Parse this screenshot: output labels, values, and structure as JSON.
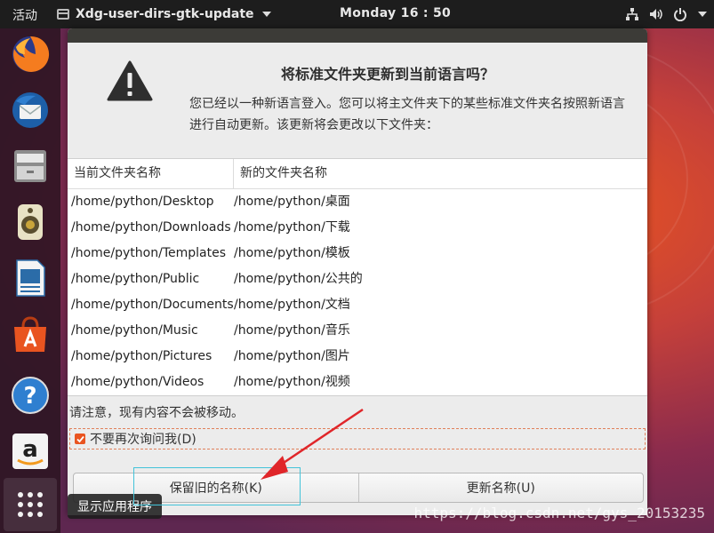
{
  "topbar": {
    "activities": "活动",
    "app_name": "Xdg-user-dirs-gtk-update",
    "clock": "Monday 16 : 50"
  },
  "dock": {
    "items": [
      "firefox-icon",
      "thunderbird-icon",
      "files-icon",
      "rhythmbox-icon",
      "libreoffice-writer-icon",
      "software-center-icon",
      "help-icon",
      "amazon-icon"
    ],
    "show_apps_tooltip": "显示应用程序"
  },
  "dialog": {
    "title": "将标准文件夹更新到当前语言吗？",
    "description": "您已经以一种新语言登入。您可以将主文件夹下的某些标准文件夹名按照新语言进行自动更新。该更新将会更改以下文件夹：",
    "columns": [
      "当前文件夹名称",
      "新的文件夹名称"
    ],
    "rows": [
      [
        "/home/python/Desktop",
        "/home/python/桌面"
      ],
      [
        "/home/python/Downloads",
        "/home/python/下载"
      ],
      [
        "/home/python/Templates",
        "/home/python/模板"
      ],
      [
        "/home/python/Public",
        "/home/python/公共的"
      ],
      [
        "/home/python/Documents",
        "/home/python/文档"
      ],
      [
        "/home/python/Music",
        "/home/python/音乐"
      ],
      [
        "/home/python/Pictures",
        "/home/python/图片"
      ],
      [
        "/home/python/Videos",
        "/home/python/视频"
      ]
    ],
    "notice": "请注意，现有内容不会被移动。",
    "checkbox_label": "不要再次询问我(D)",
    "checkbox_checked": true,
    "keep_button": "保留旧的名称(K)",
    "update_button": "更新名称(U)"
  },
  "watermark": "https://blog.csdn.net/gys_20153235",
  "colors": {
    "accent": "#e95420",
    "topbar": "#1d1d1d",
    "annotation_arrow": "#e0262a",
    "focus_outline": "#42c3d9"
  }
}
